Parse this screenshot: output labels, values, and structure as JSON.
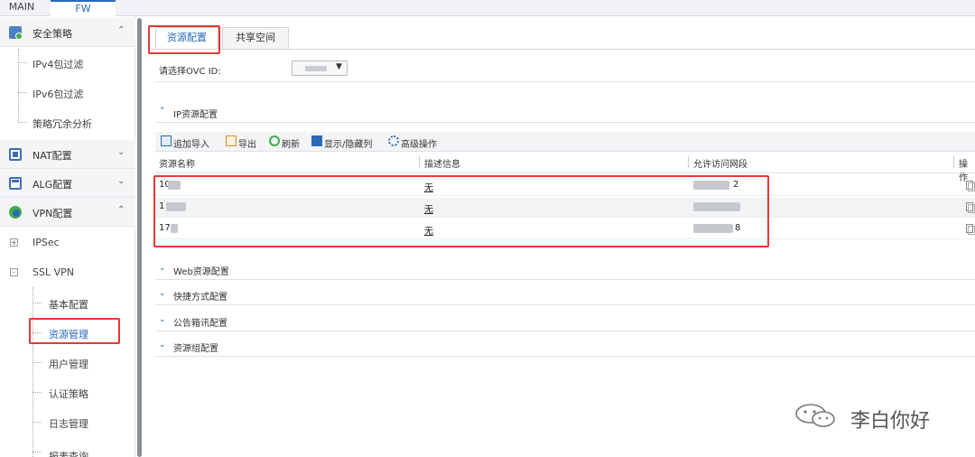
{
  "top_tabs": {
    "main": "MAIN",
    "fw": "FW"
  },
  "sidebar": {
    "groups": [
      {
        "label": "安全策略",
        "icon": "security-policy-icon",
        "chevron": "^"
      },
      {
        "label": "NAT配置",
        "icon": "nat-icon",
        "chevron": "v"
      },
      {
        "label": "ALG配置",
        "icon": "alg-icon",
        "chevron": "v"
      },
      {
        "label": "VPN配置",
        "icon": "vpn-icon",
        "chevron": "^"
      }
    ],
    "policy_items": [
      "IPv4包过滤",
      "IPv6包过滤",
      "策略冗余分析"
    ],
    "vpn_nodes": [
      {
        "label": "IPSec",
        "toggle": "+"
      },
      {
        "label": "SSL VPN",
        "toggle": "-"
      }
    ],
    "sslvpn_items": [
      "基本配置",
      "资源管理",
      "用户管理",
      "认证策略",
      "日志管理",
      "报表查询"
    ],
    "selected": "资源管理"
  },
  "content": {
    "tabs": [
      "资源配置",
      "共享空间"
    ],
    "active_tab": "资源配置",
    "ovc_label": "请选择OVC ID:",
    "sections": {
      "ip": "IP资源配置",
      "web": "Web资源配置",
      "shortcut": "快捷方式配置",
      "notice": "公告箱讯配置",
      "group": "资源组配置"
    },
    "toolbar": [
      {
        "label": "追加导入",
        "icon": "import-icon"
      },
      {
        "label": "导出",
        "icon": "export-icon"
      },
      {
        "label": "刷新",
        "icon": "refresh-icon"
      },
      {
        "label": "显示/隐藏列",
        "icon": "columns-icon"
      },
      {
        "label": "高级操作",
        "icon": "advanced-icon"
      }
    ],
    "table": {
      "columns": [
        "资源名称",
        "描述信息",
        "允许访问网段",
        "操作"
      ],
      "rows": [
        {
          "name": "10",
          "desc": "无",
          "net_tail": "2"
        },
        {
          "name": "1",
          "desc": "无",
          "net_tail": ""
        },
        {
          "name": "17",
          "desc": "无",
          "net_tail": "8"
        }
      ]
    }
  },
  "watermark": {
    "text": "李白你好",
    "icon": "wechat-icon"
  },
  "colors": {
    "accent": "#2a69b8",
    "highlight": "#e53935"
  }
}
